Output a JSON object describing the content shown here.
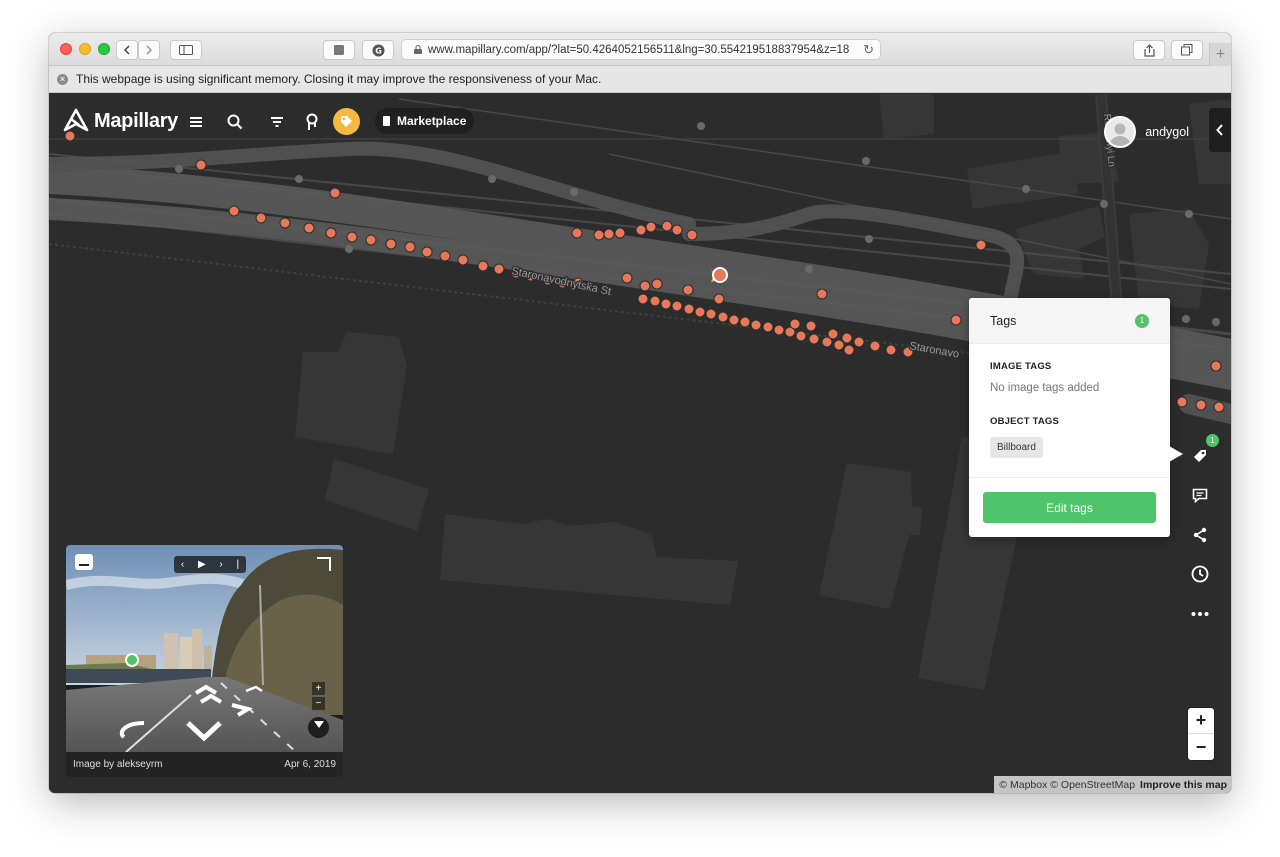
{
  "browser": {
    "url": "www.mapillary.com/app/?lat=50.4264052156511&lng=30.554219518837954&z=18"
  },
  "banner": {
    "message": "This webpage is using significant memory. Closing it may improve the responsiveness of your Mac."
  },
  "header": {
    "logo_text": "Mapillary",
    "marketplace_label": "Marketplace",
    "username": "andygol"
  },
  "map": {
    "street_label_1": "Staronavodnytska St",
    "street_label_2": "Staronavo",
    "street_label_3": "Redutnyi Ln",
    "attribution_mapbox": "© Mapbox",
    "attribution_osm": "© OpenStreetMap",
    "improve_link": "Improve this map"
  },
  "tags_panel": {
    "title": "Tags",
    "count": "1",
    "image_tags_title": "IMAGE TAGS",
    "image_tags_empty": "No image tags added",
    "object_tags_title": "OBJECT TAGS",
    "object_tags": [
      "Billboard"
    ],
    "edit_button": "Edit tags"
  },
  "side_toolbar": {
    "tag_badge_count": "1",
    "icons": [
      "tag-icon",
      "comment-icon",
      "share-icon",
      "history-icon",
      "more-icon"
    ]
  },
  "zoom": {
    "in": "+",
    "out": "−"
  },
  "viewer": {
    "image_by": "Image by alekseyrm",
    "date": "Apr 6, 2019"
  },
  "colors": {
    "accent_green": "#4ec46b",
    "sequence_orange": "#e8785a",
    "highlight_yellow": "#f5b942",
    "map_background": "#2c2c2c"
  }
}
